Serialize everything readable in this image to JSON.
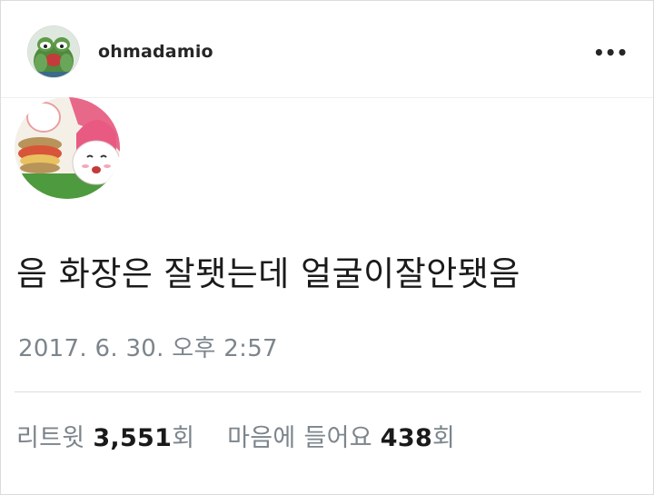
{
  "post": {
    "username": "ohmadamio",
    "more_label": "•••",
    "avatar_icon": "pepe-frog-avatar-icon",
    "tweet": {
      "avatar_icon": "cartoon-characters-avatar-icon",
      "text": "음 화장은 잘됏는데 얼굴이잘안됏음",
      "timestamp": "2017. 6. 30. 오후 2:57",
      "retweets_label": "리트윗",
      "retweets_count": "3,551",
      "retweets_unit": "회",
      "likes_label": "마음에 들어요",
      "likes_count": "438",
      "likes_unit": "회"
    }
  },
  "colors": {
    "text": "#262626",
    "muted": "#7c858c",
    "divider": "#d9dde0"
  }
}
